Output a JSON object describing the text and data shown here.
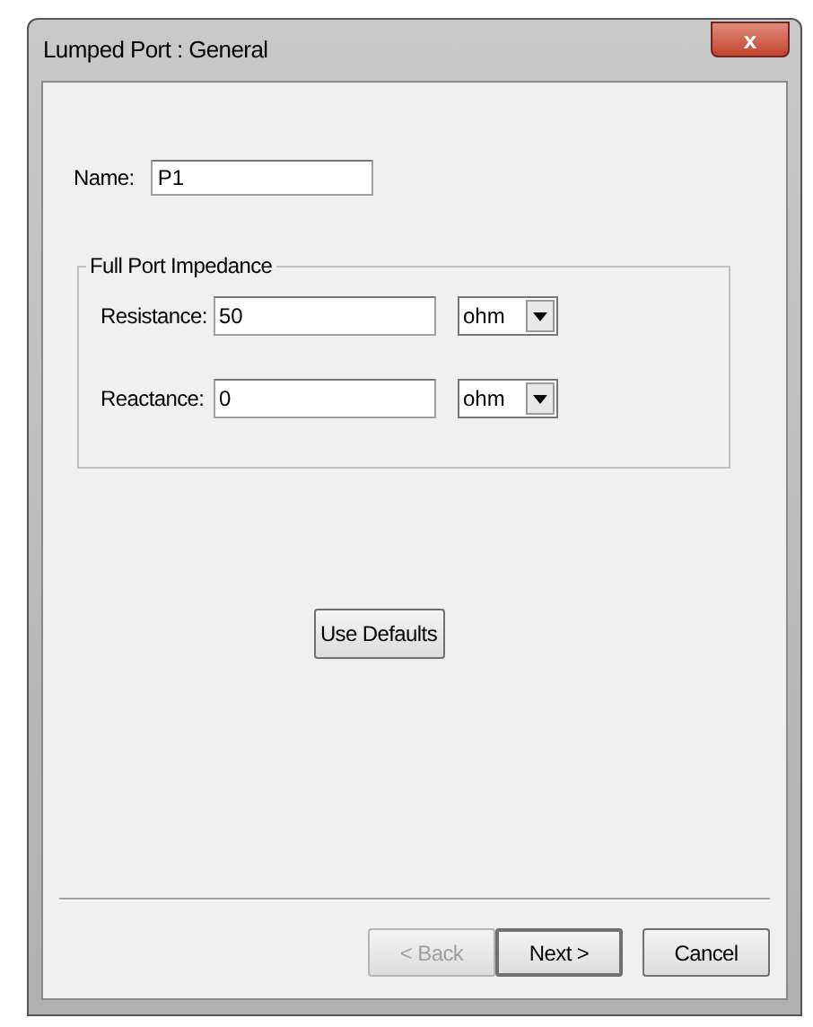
{
  "window": {
    "title": "Lumped Port : General",
    "close": "x"
  },
  "name_field": {
    "label": "Name:",
    "value": "P1"
  },
  "group": {
    "title": "Full Port Impedance",
    "rows": [
      {
        "label": "Resistance:",
        "value": "50",
        "unit": "ohm"
      },
      {
        "label": "Reactance:",
        "value": "0",
        "unit": "ohm"
      }
    ]
  },
  "use_defaults": {
    "label": "Use Defaults"
  },
  "buttons": [
    {
      "label": "< Back",
      "disabled": true,
      "default": false
    },
    {
      "label": "Next >",
      "disabled": false,
      "default": true
    },
    {
      "label": "Cancel",
      "disabled": false,
      "default": false
    }
  ]
}
